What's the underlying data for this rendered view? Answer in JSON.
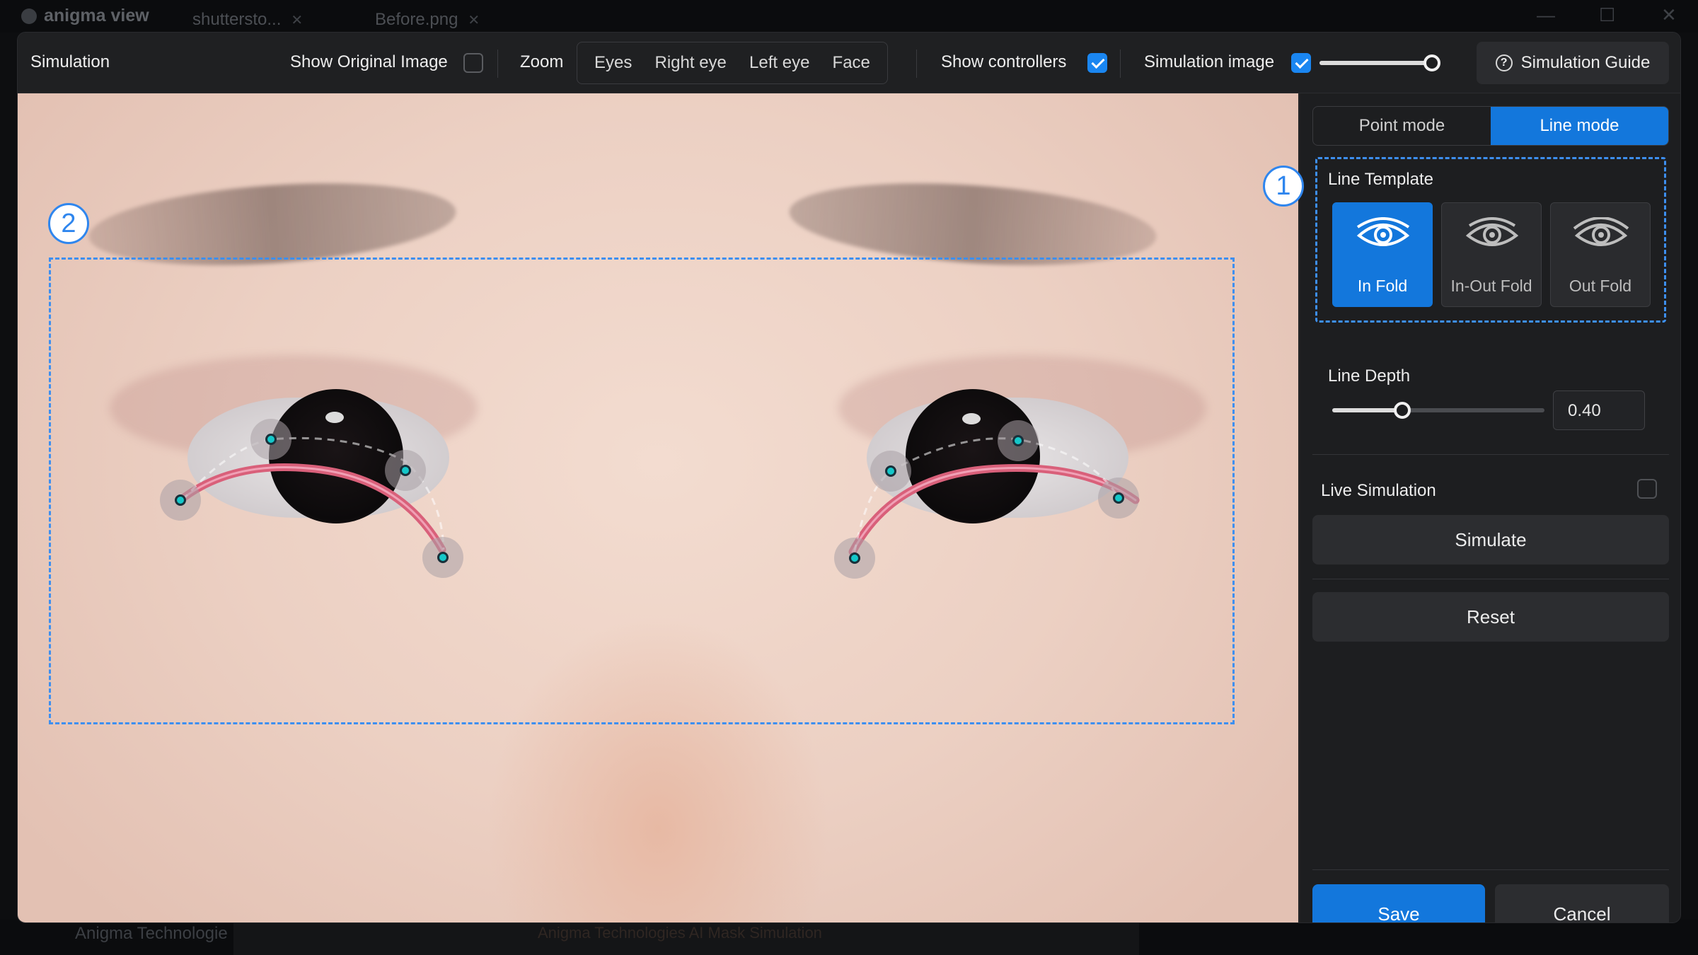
{
  "background_app": {
    "app_name": "anigma view",
    "tabs": [
      {
        "label": "shuttersto..."
      },
      {
        "label": "Before.png"
      }
    ],
    "company": "Anigma Technologie",
    "footer_text": "Anigma Technologies AI Mask Simulation"
  },
  "toolbar": {
    "title": "Simulation",
    "show_original_label": "Show Original Image",
    "show_original_checked": false,
    "zoom_label": "Zoom",
    "zoom_options": [
      "Eyes",
      "Right eye",
      "Left eye",
      "Face"
    ],
    "show_controllers_label": "Show controllers",
    "show_controllers_checked": true,
    "simulation_image_label": "Simulation image",
    "simulation_image_checked": true,
    "simulation_opacity_fraction": 0.97,
    "guide_label": "Simulation Guide",
    "guide_icon": "question-circle-icon"
  },
  "canvas": {
    "badge_2": "2",
    "badge_1": "1"
  },
  "panel": {
    "mode_point": "Point mode",
    "mode_line": "Line mode",
    "selected_mode": "Line mode",
    "line_template_title": "Line Template",
    "templates": [
      {
        "label": "In Fold",
        "icon": "eye-icon",
        "selected": true
      },
      {
        "label": "In-Out Fold",
        "icon": "eye-icon",
        "selected": false
      },
      {
        "label": "Out Fold",
        "icon": "eye-icon",
        "selected": false
      }
    ],
    "line_depth_label": "Line Depth",
    "line_depth_value": "0.40",
    "line_depth_fraction": 0.33,
    "live_simulation_label": "Live Simulation",
    "live_simulation_checked": false,
    "simulate_label": "Simulate",
    "reset_label": "Reset",
    "save_label": "Save",
    "cancel_label": "Cancel"
  },
  "colors": {
    "accent": "#1377dc",
    "dashed_outline": "#3d8ff0",
    "controller_dot": "#15c7c9",
    "fold_line": "#d9607a"
  }
}
